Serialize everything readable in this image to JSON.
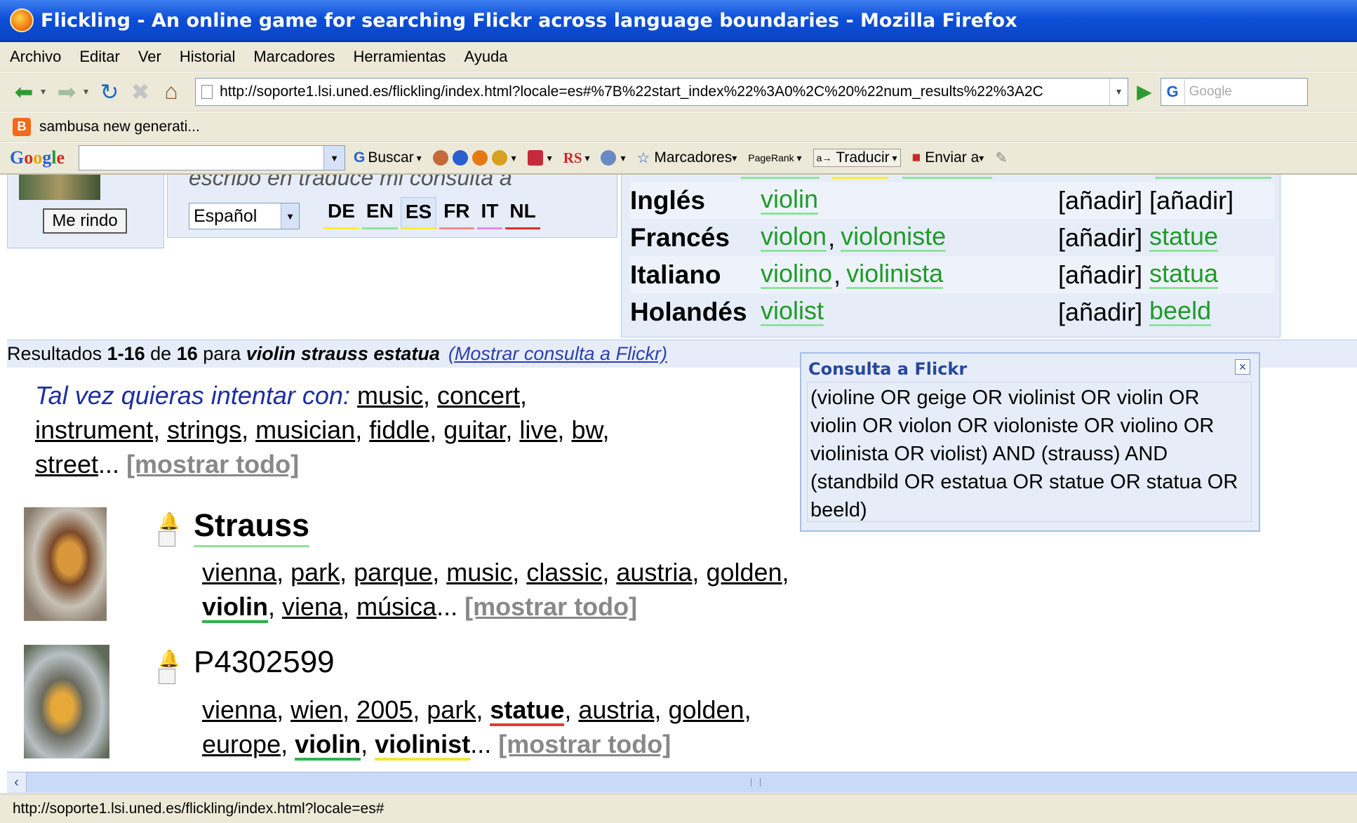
{
  "window": {
    "title": "Flickling - An online game for searching Flickr across language boundaries - Mozilla Firefox"
  },
  "menu": [
    "Archivo",
    "Editar",
    "Ver",
    "Historial",
    "Marcadores",
    "Herramientas",
    "Ayuda"
  ],
  "nav": {
    "url": "http://soporte1.lsi.uned.es/flickling/index.html?locale=es#%7B%22start_index%22%3A0%2C%20%22num_results%22%3A2C",
    "search_placeholder": "Google"
  },
  "bookmarks": {
    "item": "sambusa new generati..."
  },
  "google_toolbar": {
    "logo": "Google",
    "buscar": "Buscar",
    "rs": "RS",
    "marcadores": "Marcadores",
    "pagerank": "PageRank",
    "traducir": "Traducir",
    "enviar": "Enviar a"
  },
  "game": {
    "give_up": "Me rindo",
    "partial_prompt": "escribo en traduce mi consulta a",
    "language_select": "Español",
    "lang_tabs": [
      {
        "code": "DE",
        "color": "#ffeb3b"
      },
      {
        "code": "EN",
        "color": "#8fe39b"
      },
      {
        "code": "ES",
        "color": "#ffeb3b"
      },
      {
        "code": "FR",
        "color": "#f48b8b"
      },
      {
        "code": "IT",
        "color": "#e58ae5"
      },
      {
        "code": "NL",
        "color": "#d93030"
      }
    ]
  },
  "translations": {
    "add_label": "[añadir]",
    "rows": [
      {
        "lang": "Inglés",
        "words": [
          "violin"
        ],
        "col2": "[añadir]",
        "col2_is_word": false
      },
      {
        "lang": "Francés",
        "words": [
          "violon",
          "violoniste"
        ],
        "col2": "statue",
        "col2_is_word": true
      },
      {
        "lang": "Italiano",
        "words": [
          "violino",
          "violinista"
        ],
        "col2": "statua",
        "col2_is_word": true
      },
      {
        "lang": "Holandés",
        "words": [
          "violist"
        ],
        "col2": "beeld",
        "col2_is_word": true
      }
    ]
  },
  "results_bar": {
    "prefix": "Resultados ",
    "range": "1-16",
    "of": " de ",
    "total": "16",
    "para": " para ",
    "query": "violin strauss estatua",
    "show_query": "(Mostrar consulta a Flickr)"
  },
  "suggestions": {
    "lead": "Tal vez quieras intentar con:",
    "tags": [
      "music",
      "concert",
      "instrument",
      "strings",
      "musician",
      "fiddle",
      "guitar",
      "live",
      "bw",
      "street"
    ],
    "more": "[mostrar todo]"
  },
  "query_popup": {
    "title": "Consulta a Flickr",
    "close": "×",
    "text": "(violine OR geige OR violinist OR violin OR violin OR violon OR violoniste OR violino OR violinista OR violist) AND (strauss) AND (standbild OR estatua OR statue OR statua OR beeld)"
  },
  "results": [
    {
      "title": "Strauss",
      "tags_line1": [
        "vienna",
        "park",
        "parque",
        "music",
        "classic",
        "austria",
        "golden"
      ],
      "tags_line2_highlight": "violin",
      "tags_line2": [
        "viena",
        "música"
      ],
      "more": "[mostrar todo]"
    },
    {
      "title": "P4302599",
      "tags_line1a": [
        "vienna",
        "wien",
        "2005",
        "park"
      ],
      "tags_line1_highlight": "statue",
      "tags_line1b": [
        "austria",
        "golden"
      ],
      "tags_line2a": "europe",
      "tags_line2_hl1": "violin",
      "tags_line2_hl2": "violinist",
      "more": "[mostrar todo]"
    }
  ],
  "status": {
    "url": "http://soporte1.lsi.uned.es/flickling/index.html?locale=es#"
  }
}
